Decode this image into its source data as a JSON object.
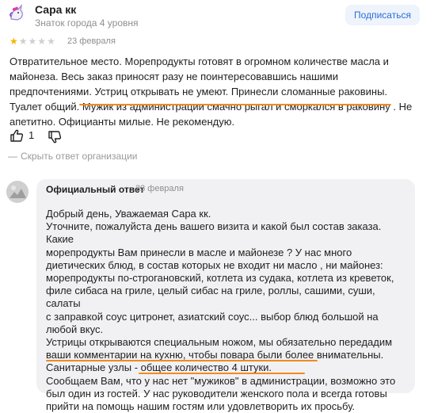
{
  "header": {
    "user_name": "Сара кк",
    "user_level": "Знаток города 4 уровня",
    "subscribe_label": "Подписаться"
  },
  "review": {
    "rating": 1,
    "rating_max": 5,
    "date": "23 февраля",
    "lines": [
      "Отвратительное место. Морепродукты готовят в огромном количестве масла и",
      "майонеза. Весь заказ приносят разу не поинтересовавшись нашими",
      "предпочтениями. Устриц открывать не умеют. Принесли сломанные раковины.",
      "Туалет общий. Мужик из администрации смачно рыгал и сморкался в раковину . Не",
      "апетитно. Официанты милые. Не рекомендую."
    ],
    "likes": "1",
    "hide_label": "Скрыть ответ организации"
  },
  "official": {
    "label": "Официальный ответ",
    "date": "23 февраля",
    "lines": [
      "Добрый день, Уважаемая Сара кк.",
      "Уточните, пожалуйста день вашего визита и какой был состав заказа. Какие",
      "морепродукты Вам принесли в масле и майонезе ? У нас много",
      "диетических блюд, в состав которых не входит ни масло , ни майонез:",
      "морепродукты по-строгановский, котлета из судака, котлета из креветок,",
      "филе сибаса на гриле, целый сибас на гриле, роллы, сашими, суши, салаты",
      "с заправкой соус цитронет, азиатский соус... выбор блюд большой на",
      "любой вкус.",
      "Устрицы открываются специальным ножом, мы обязательно передадим",
      "ваши комментарии на кухню, чтобы повара были более внимательны.",
      "Санитарные узлы - общее количество 4 штуки.",
      "Сообщаем Вам, что у нас нет \"мужиков\" в администрации,  возможно это",
      "был один из гостей. У нас руководители женского пола и всегда готовы",
      "прийти на помощь нашим гостям или удовлетворить их просьбу."
    ]
  },
  "colors": {
    "highlight": "#f28a1f",
    "star": "#f5b400",
    "accent": "#2a6fd6"
  }
}
